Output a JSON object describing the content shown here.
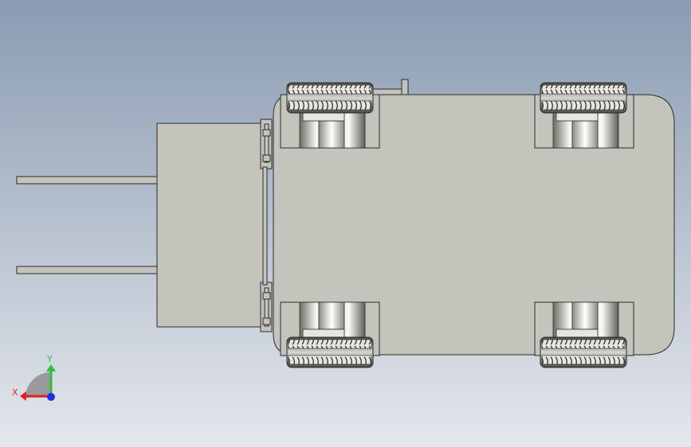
{
  "view": {
    "background_top": "#8a9bb2",
    "background_bottom": "#e4e7ec"
  },
  "model": {
    "body_color": "#c4c4bd",
    "stroke_color": "#2a2a2a",
    "wheel_well_color": "#c4c4bd"
  },
  "triad": {
    "x_label": "X",
    "y_label": "Y",
    "x_color": "#e8202a",
    "y_color": "#2fbf3a",
    "z_color": "#1e2fe0"
  }
}
